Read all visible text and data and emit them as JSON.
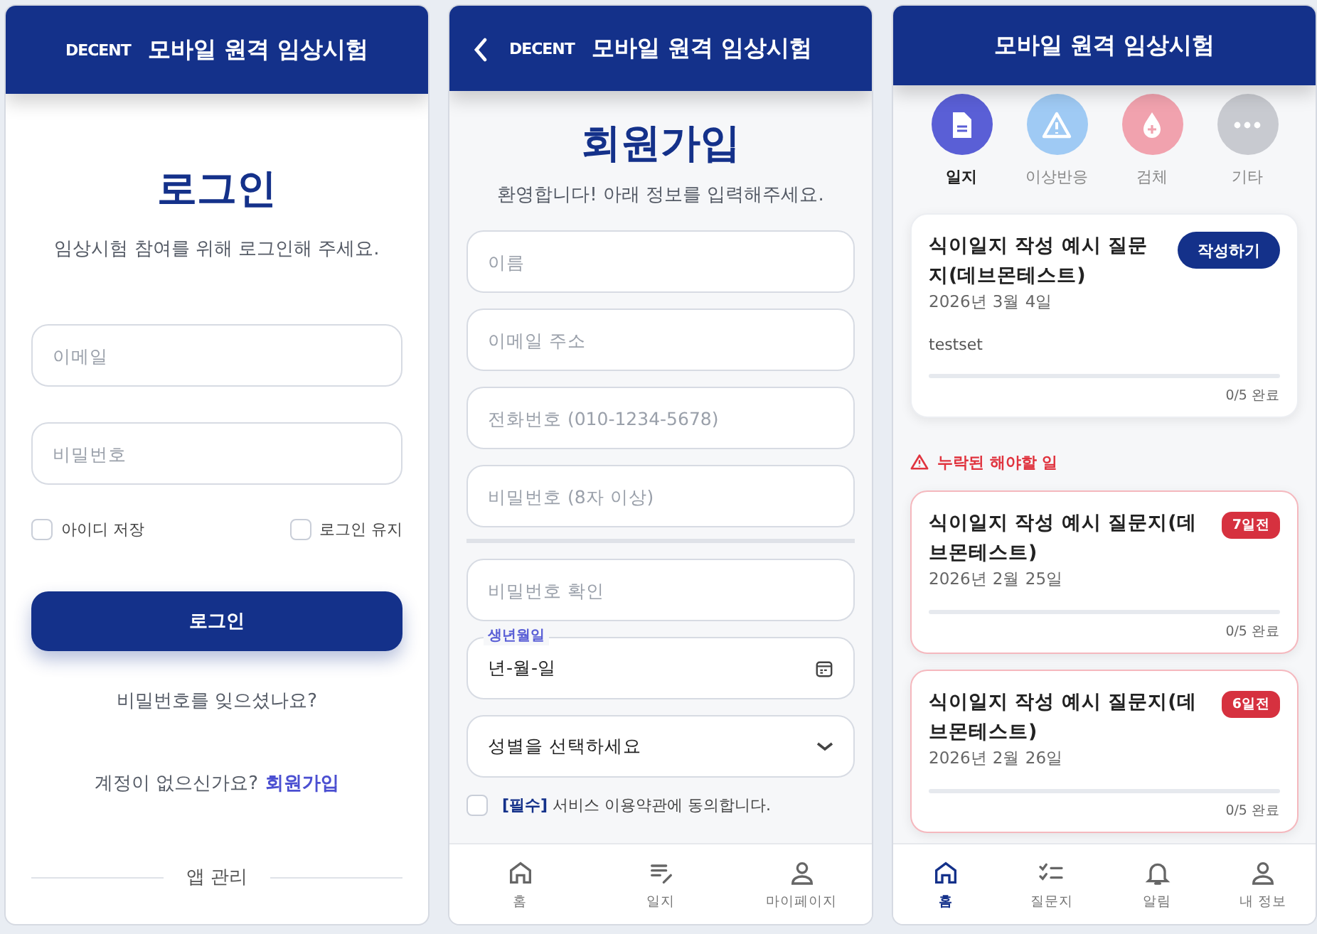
{
  "login_screen": {
    "header": {
      "logo": "DECENT",
      "title": "모바일 원격 임상시험"
    },
    "title": "로그인",
    "subtitle": "임상시험 참여를 위해 로그인해 주세요.",
    "fields": [
      {
        "placeholder": "이메일"
      },
      {
        "placeholder": "비밀번호"
      }
    ],
    "checkboxes": [
      {
        "label": "아이디 저장",
        "checked": false
      },
      {
        "label": "로그인 유지",
        "checked": false
      }
    ],
    "login_button": "로그인",
    "forgot_link": "비밀번호를 잊으셨나요?",
    "signup_prompt": "계정이 없으신가요?",
    "signup_link": "회원가입",
    "section_divider": "앱 관리"
  },
  "signup_screen": {
    "header": {
      "logo": "DECENT",
      "title": "모바일 원격 임상시험"
    },
    "title": "회원가입",
    "subtitle": "환영합니다! 아래 정보를 입력해주세요.",
    "fields": [
      {
        "kind": "text",
        "placeholder": "이름"
      },
      {
        "kind": "text",
        "placeholder": "이메일 주소"
      },
      {
        "kind": "text",
        "placeholder": "전화번호 (010-1234-5678)"
      },
      {
        "kind": "text",
        "placeholder": "비밀번호 (8자 이상)"
      },
      {
        "kind": "divider"
      },
      {
        "kind": "text",
        "placeholder": "비밀번호 확인"
      },
      {
        "kind": "date",
        "label": "생년월일",
        "value": "년-월-일"
      },
      {
        "kind": "select",
        "value": "성별을 선택하세요"
      }
    ],
    "agreement": {
      "text": "**[필수]** 서비스 이용약관에 동의합니다.",
      "checked": false
    },
    "nav": [
      {
        "kind": "home",
        "label": "홈",
        "selected": false
      },
      {
        "kind": "journal",
        "label": "일지",
        "selected": false
      },
      {
        "kind": "user",
        "label": "마이페이지",
        "selected": false
      }
    ]
  },
  "home_screen": {
    "header": {
      "title": "모바일 원격 임상시험"
    },
    "categories": [
      {
        "kind": "document",
        "label": "일지",
        "selected": true,
        "color": "#5a5fd6"
      },
      {
        "kind": "warning",
        "label": "이상반응",
        "selected": false,
        "color": "#9fcaf4"
      },
      {
        "kind": "drop",
        "label": "검체",
        "selected": false,
        "color": "#f1a2ae"
      },
      {
        "kind": "more",
        "label": "기타",
        "selected": false,
        "color": "#c8cad0"
      }
    ],
    "tasks": [
      {
        "title": "식이일지 작성 예시 질문지(데브몬테스트)",
        "action": "작성하기",
        "date": "2026년 3월 4일",
        "note": "testset",
        "level": 0,
        "progress": "0/5 완료"
      }
    ],
    "missed_heading": "누락된 해야할 일",
    "missed_tasks": [
      {
        "title": "식이일지 작성 예시 질문지(데브몬테스트)",
        "badge": "7일전",
        "date": "2026년 2월 25일",
        "level": 0,
        "progress": "0/5 완료"
      },
      {
        "title": "식이일지 작성 예시 질문지(데브몬테스트)",
        "badge": "6일전",
        "date": "2026년 2월 26일",
        "level": 0,
        "progress": "0/5 완료"
      }
    ],
    "nav": [
      {
        "kind": "home",
        "label": "홈",
        "selected": true
      },
      {
        "kind": "checklist",
        "label": "질문지",
        "selected": false
      },
      {
        "kind": "bell",
        "label": "알림",
        "selected": false
      },
      {
        "kind": "user",
        "label": "내 정보",
        "selected": false
      }
    ]
  }
}
